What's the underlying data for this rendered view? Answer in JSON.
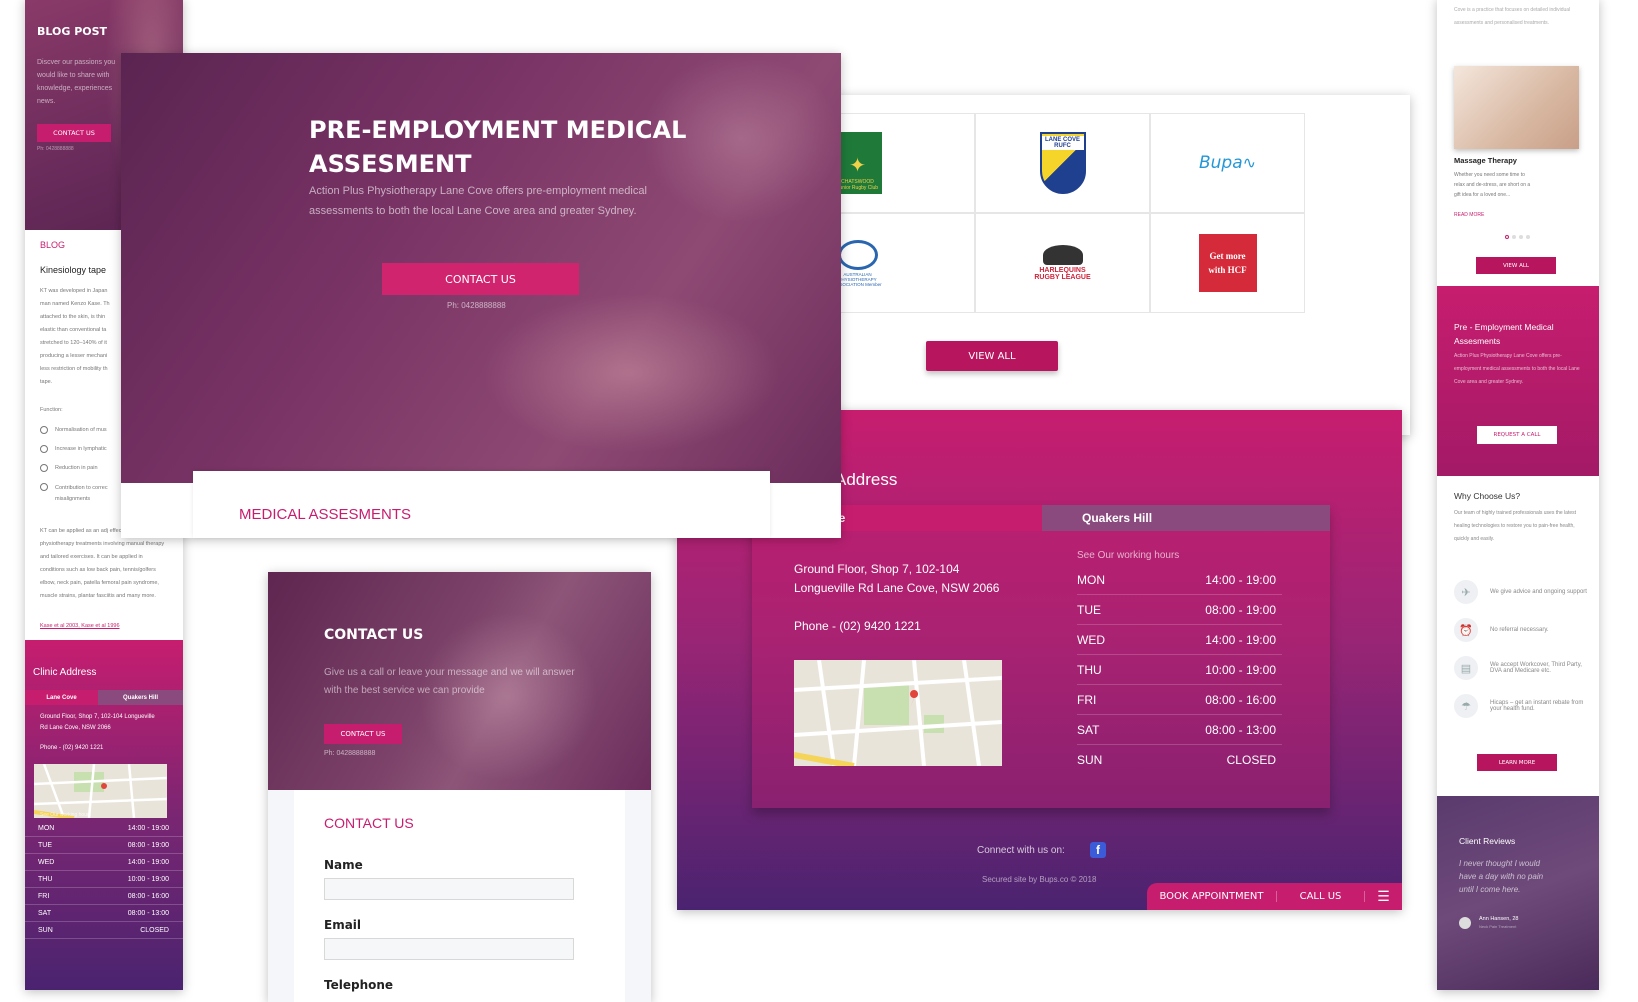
{
  "left_mobile": {
    "hero_title": "BLOG POST",
    "hero_text": "Discver our passions you would like to share with knowledge, experiences news.",
    "contact_button": "CONTACT US",
    "phone": "Ph: 0428888888",
    "blog_heading": "BLOG",
    "article_title": "Kinesiology tape",
    "article_body": "KT was developed in Japan man named Kenzo Kase. Th attached to the skin, is thin elastic than conventional ta stretched to 120–140% of it producing a lesser mechani less restriction of mobility th tape.",
    "function_label": "Function:",
    "bullets": [
      "Normalisation of mus",
      "Increase in lymphatic",
      "Reduction in pain",
      "Contribution to correc misalignments"
    ],
    "body2": "KT can be applied as an adj effectiveness of physiotherapy treatments involving manual therapy and tailored exercises. It can be applied in conditions such as low back pain, tennis/golfers elbow, neck pain, patella femoral pain syndrome, muscle strains, plantar fasciitis and many more.",
    "refs": "Kase et al 2003, Kase et al 1996",
    "clinic_heading": "Clinic Address",
    "tabs": [
      "Lane Cove",
      "Quakers Hill"
    ],
    "address": "Ground Floor, Shop 7, 102-104 Longueville Rd Lane Cove, NSW 2066",
    "phone_line": "Phone - (02) 9420 1221",
    "hours_label": "See Our working hours",
    "hours": [
      [
        "MON",
        "14:00 - 19:00"
      ],
      [
        "TUE",
        "08:00 - 19:00"
      ],
      [
        "WED",
        "14:00 - 19:00"
      ],
      [
        "THU",
        "10:00 - 19:00"
      ],
      [
        "FRI",
        "08:00 - 16:00"
      ],
      [
        "SAT",
        "08:00 - 13:00"
      ],
      [
        "SUN",
        "CLOSED"
      ]
    ]
  },
  "hero_card": {
    "title_line1": "PRE-EMPLOYMENT MEDICAL",
    "title_line2": "ASSESMENT",
    "text": "Action Plus Physiotherapy Lane Cove offers pre-employment medical assessments to both the local Lane Cove area and greater Sydney.",
    "button": "CONTACT US",
    "phone": "Ph: 0428888888",
    "section_heading": "MEDICAL ASSESMENTS"
  },
  "partners_card": {
    "logos": [
      "CHATSWOOD Junior Rugby Club",
      "LANE COVE RUFC",
      "Bupa",
      "AUSTRALIAN PHYSIOTHERAPY ASSOCIATION Member",
      "HARLEQUINS RUGBY LEAGUE",
      "Get more with HCF"
    ],
    "button": "VIEW ALL"
  },
  "address_card": {
    "heading": "Address",
    "tab_active": "ve",
    "tab_other": "Quakers Hill",
    "address_line1": "Ground Floor, Shop 7, 102-104",
    "address_line2": "Longueville Rd Lane Cove, NSW 2066",
    "phone": "Phone - (02) 9420 1221",
    "hours_label": "See Our working hours",
    "hours": [
      [
        "MON",
        "14:00 - 19:00"
      ],
      [
        "TUE",
        "08:00 - 19:00"
      ],
      [
        "WED",
        "14:00 - 19:00"
      ],
      [
        "THU",
        "10:00 - 19:00"
      ],
      [
        "FRI",
        "08:00 - 16:00"
      ],
      [
        "SAT",
        "08:00 - 13:00"
      ],
      [
        "SUN",
        "CLOSED"
      ]
    ],
    "connect": "Connect with us on:",
    "footer": "Secured site by Bups.co © 2018",
    "book": "BOOK APPOINTMENT",
    "call": "CALL US"
  },
  "contact_card": {
    "hero_title": "CONTACT US",
    "hero_text": "Give us a call or leave your message and we will answer with the best service we can provide",
    "button": "CONTACT US",
    "phone": "Ph: 0428888888",
    "form_heading": "CONTACT US",
    "labels": [
      "Name",
      "Email",
      "Telephone"
    ]
  },
  "right_mobile": {
    "intro": "Cove is a practice that focuses on detailed individual assessments and personalised treatments.",
    "service_title": "Massage Therapy",
    "service_text": "Whether you need some time to relax and de-stress, are short on a gift idea for a loved one...",
    "read_more": "READ MORE",
    "view_all": "VIEW ALL",
    "pre_title": "Pre - Employment Medical Assesments",
    "pre_text": "Action Plus Physiotherapy Lane Cove offers pre-employment medical assessments to both the local Lane Cove area and greater Sydney.",
    "request": "REQUEST A CALL",
    "why_title": "Why Choose Us?",
    "why_text": "Our team of highly trained professionals uses the latest healing technologies to restore you to pain-free health, quickly and easily.",
    "features": [
      "We give advice and ongoing support",
      "No referral necessary.",
      "We accept Workcover, Third Party, DVA and Medicare etc.",
      "Hicaps – get an instant rebate from your health fund."
    ],
    "learn": "LEARN MORE",
    "reviews_title": "Client Reviews",
    "quote": "I never thought I would have a day with no pain until I come here.",
    "reviewer": "Ann Hansen, 28",
    "reviewer_sub": "Neck Pain Treatment"
  },
  "colors": {
    "magenta": "#c71d6f",
    "plum": "#6b2c5c",
    "purple": "#4a2370"
  }
}
